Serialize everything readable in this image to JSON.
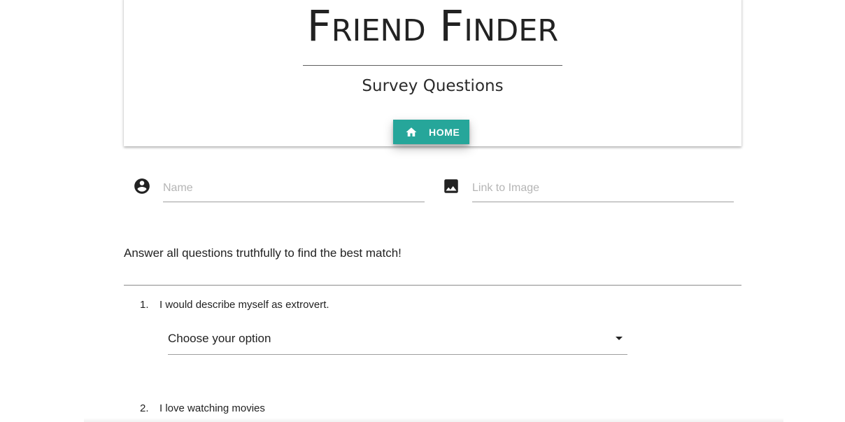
{
  "header": {
    "title": "Friend Finder",
    "subtitle": "Survey Questions",
    "home_button": {
      "label": "HOME",
      "icon": "home-icon",
      "color": "#26a69a"
    }
  },
  "form": {
    "name_field": {
      "icon": "account-circle-icon",
      "placeholder": "Name",
      "value": ""
    },
    "image_field": {
      "icon": "image-icon",
      "placeholder": "Link to Image",
      "value": ""
    }
  },
  "instructions": "Answer all questions truthfully to find the best match!",
  "questions": [
    {
      "number": "1.",
      "text": "I would describe myself as extrovert.",
      "selected": "Choose your option"
    },
    {
      "number": "2.",
      "text": "I love watching movies"
    }
  ]
}
